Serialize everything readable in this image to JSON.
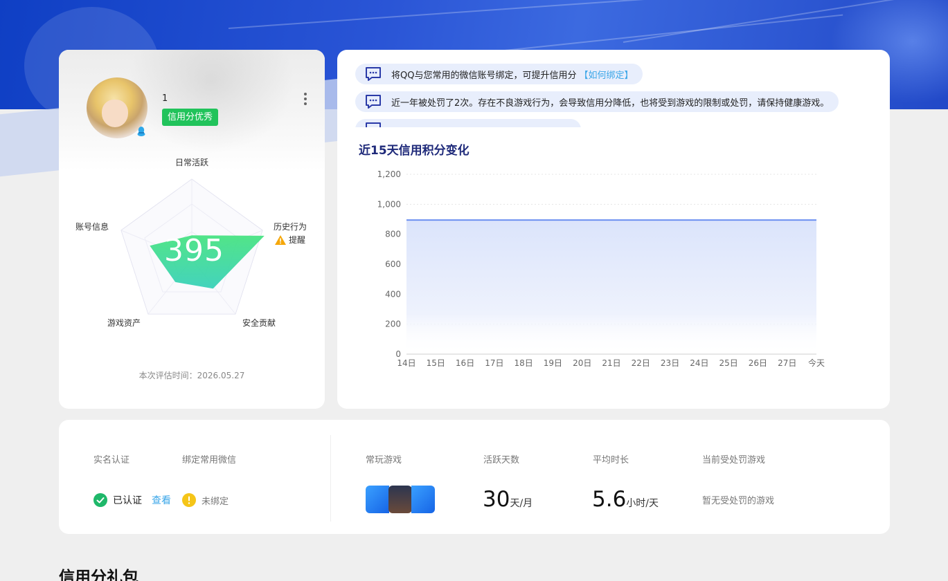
{
  "profile": {
    "nickname": "1",
    "badge": "信用分优秀",
    "score": "395",
    "eval_time": "本次评估时间：2026.05.27",
    "radar": {
      "labels": [
        "日常活跃",
        "历史行为",
        "安全贡献",
        "游戏资产",
        "账号信息"
      ],
      "values": [
        0.3,
        0.95,
        0.45,
        0.35,
        0.55
      ],
      "warning_label": "提醒"
    }
  },
  "notices": [
    {
      "text": "将QQ与您常用的微信账号绑定，可提升信用分",
      "link": "【如何绑定】"
    },
    {
      "text": "近一年被处罚了2次。存在不良游戏行为，会导致信用分降低，也将受到游戏的限制或处罚，请保持健康游戏。",
      "link": ""
    }
  ],
  "chart": {
    "title": "近15天信用积分变化"
  },
  "chart_data": {
    "type": "area",
    "x": [
      "14日",
      "15日",
      "16日",
      "17日",
      "18日",
      "19日",
      "20日",
      "21日",
      "22日",
      "23日",
      "24日",
      "25日",
      "26日",
      "27日",
      "今天"
    ],
    "values": [
      895,
      895,
      895,
      895,
      895,
      895,
      895,
      895,
      895,
      895,
      895,
      895,
      895,
      895,
      895
    ],
    "y_ticks": [
      "0",
      "200",
      "400",
      "600",
      "800",
      "1,000",
      "1,200"
    ],
    "ylim": [
      0,
      1200
    ],
    "grid": true,
    "color": "#6b8ff0"
  },
  "stats": {
    "realname_label": "实名认证",
    "wechat_label": "绑定常用微信",
    "realname_value": "已认证",
    "realname_link": "查看",
    "wechat_value": "未绑定",
    "games_label": "常玩游戏",
    "active_days_label": "活跃天数",
    "active_days": "30",
    "active_days_unit": "天/月",
    "avg_time_label": "平均时长",
    "avg_time": "5.6",
    "avg_time_unit": "小时/天",
    "penalty_label": "当前受处罚游戏",
    "penalty_value": "暂无受处罚的游戏"
  },
  "gift_title": "信用分礼包",
  "colors": {
    "brand_blue": "#1f48c9",
    "badge_green": "#21c35b",
    "link_blue": "#3aa6e8",
    "warn_yellow": "#f5c518"
  }
}
